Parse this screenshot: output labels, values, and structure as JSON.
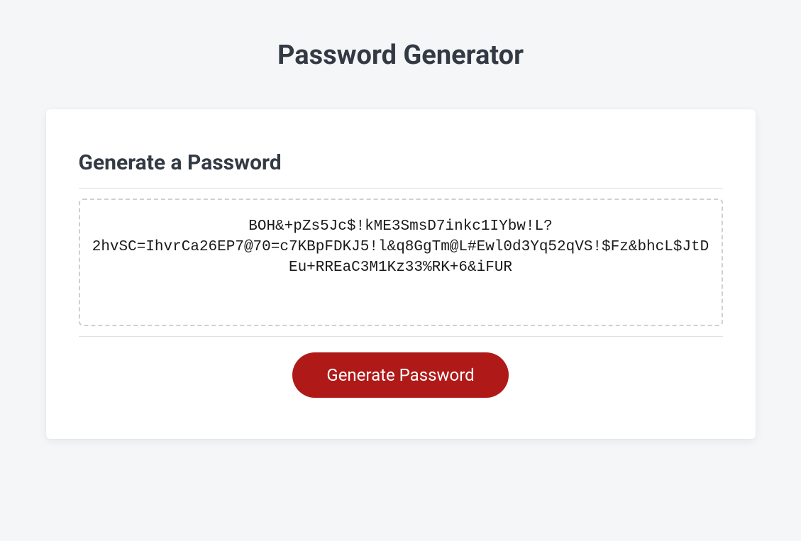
{
  "page": {
    "title": "Password Generator"
  },
  "card": {
    "heading": "Generate a Password",
    "password": "BOH&+pZs5Jc$!kME3SmsD7inkc1IYbw!L?2hvSC=IhvrCa26EP7@70=c7KBpFDKJ5!l&q8GgTm@L#Ewl0d3Yq52qVS!$Fz&bhcL$JtDEu+RREaC3M1Kz33%RK+6&iFUR",
    "button_label": "Generate Password"
  }
}
